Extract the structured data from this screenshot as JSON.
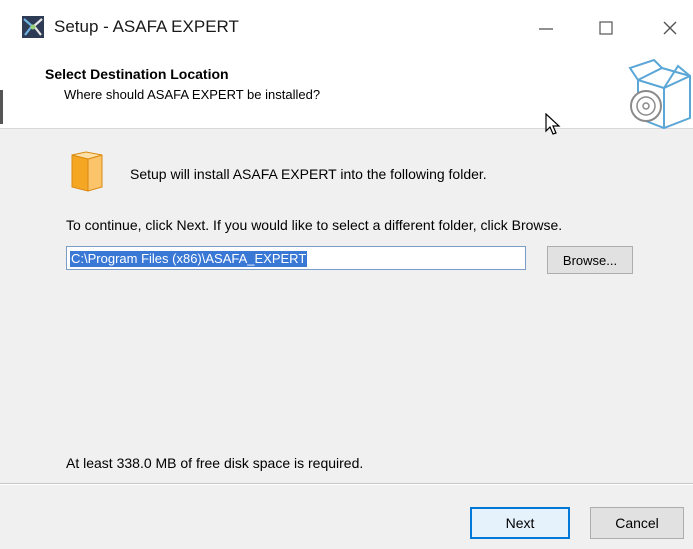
{
  "window": {
    "title": "Setup - ASAFA EXPERT",
    "icon": "installer-icon",
    "controls": {
      "minimize": "—",
      "maximize": "☐",
      "close": "✕"
    }
  },
  "header": {
    "title": "Select Destination Location",
    "subtitle": "Where should ASAFA EXPERT be installed?",
    "icon": "software-box-disc-icon"
  },
  "body": {
    "intro": "Setup will install ASAFA EXPERT into the following folder.",
    "instruction": "To continue, click Next. If you would like to select a different folder, click Browse.",
    "path_value": "C:\\Program Files (x86)\\ASAFA_EXPERT",
    "browse_label": "Browse...",
    "disk_space": "At least 338.0 MB of free disk space is required.",
    "folder_icon": "folder-icon"
  },
  "footer": {
    "next_label": "Next",
    "cancel_label": "Cancel"
  },
  "colors": {
    "selection": "#3a78d6",
    "focus_border": "#0078d7",
    "folder": "#f5a623"
  }
}
